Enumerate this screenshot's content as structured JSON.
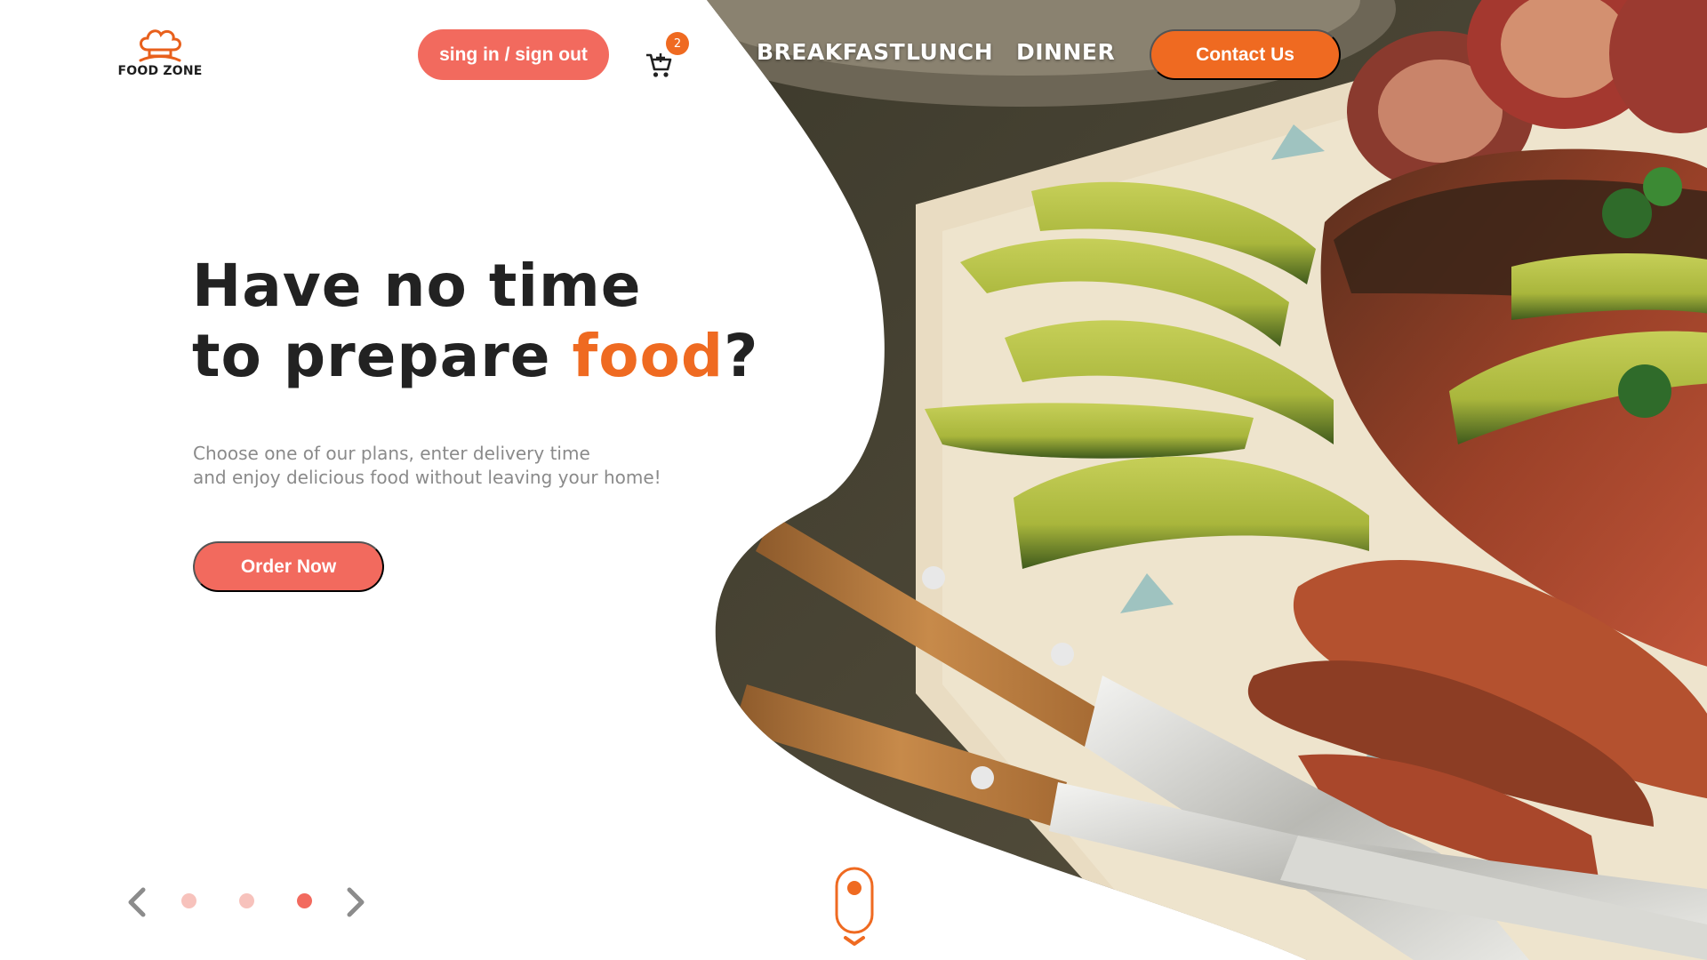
{
  "brand": {
    "name": "FOOD ZONE",
    "logo_icon": "chef-hat-icon",
    "accent_color": "#ef6a21",
    "button_color": "#f26a5e"
  },
  "header": {
    "sign_label": "sing in / sign out",
    "cart": {
      "icon": "cart-icon",
      "count": "2"
    },
    "nav": [
      "BREAKFAST",
      "LUNCH",
      "DINNER"
    ],
    "contact_label": "Contact Us"
  },
  "hero": {
    "headline_line1": "Have no time",
    "headline_line2_prefix": "to prepare ",
    "headline_accent": "food",
    "headline_suffix": "?",
    "subtext_line1": "Choose one of our plans, enter delivery time",
    "subtext_line2": "and enjoy delicious food without leaving your home!",
    "cta_label": "Order Now"
  },
  "slider": {
    "prev_icon": "chevron-left-icon",
    "next_icon": "chevron-right-icon",
    "slide_count": 3,
    "active_index": 2
  },
  "scroll_indicator": {
    "icon": "mouse-scroll-icon"
  }
}
